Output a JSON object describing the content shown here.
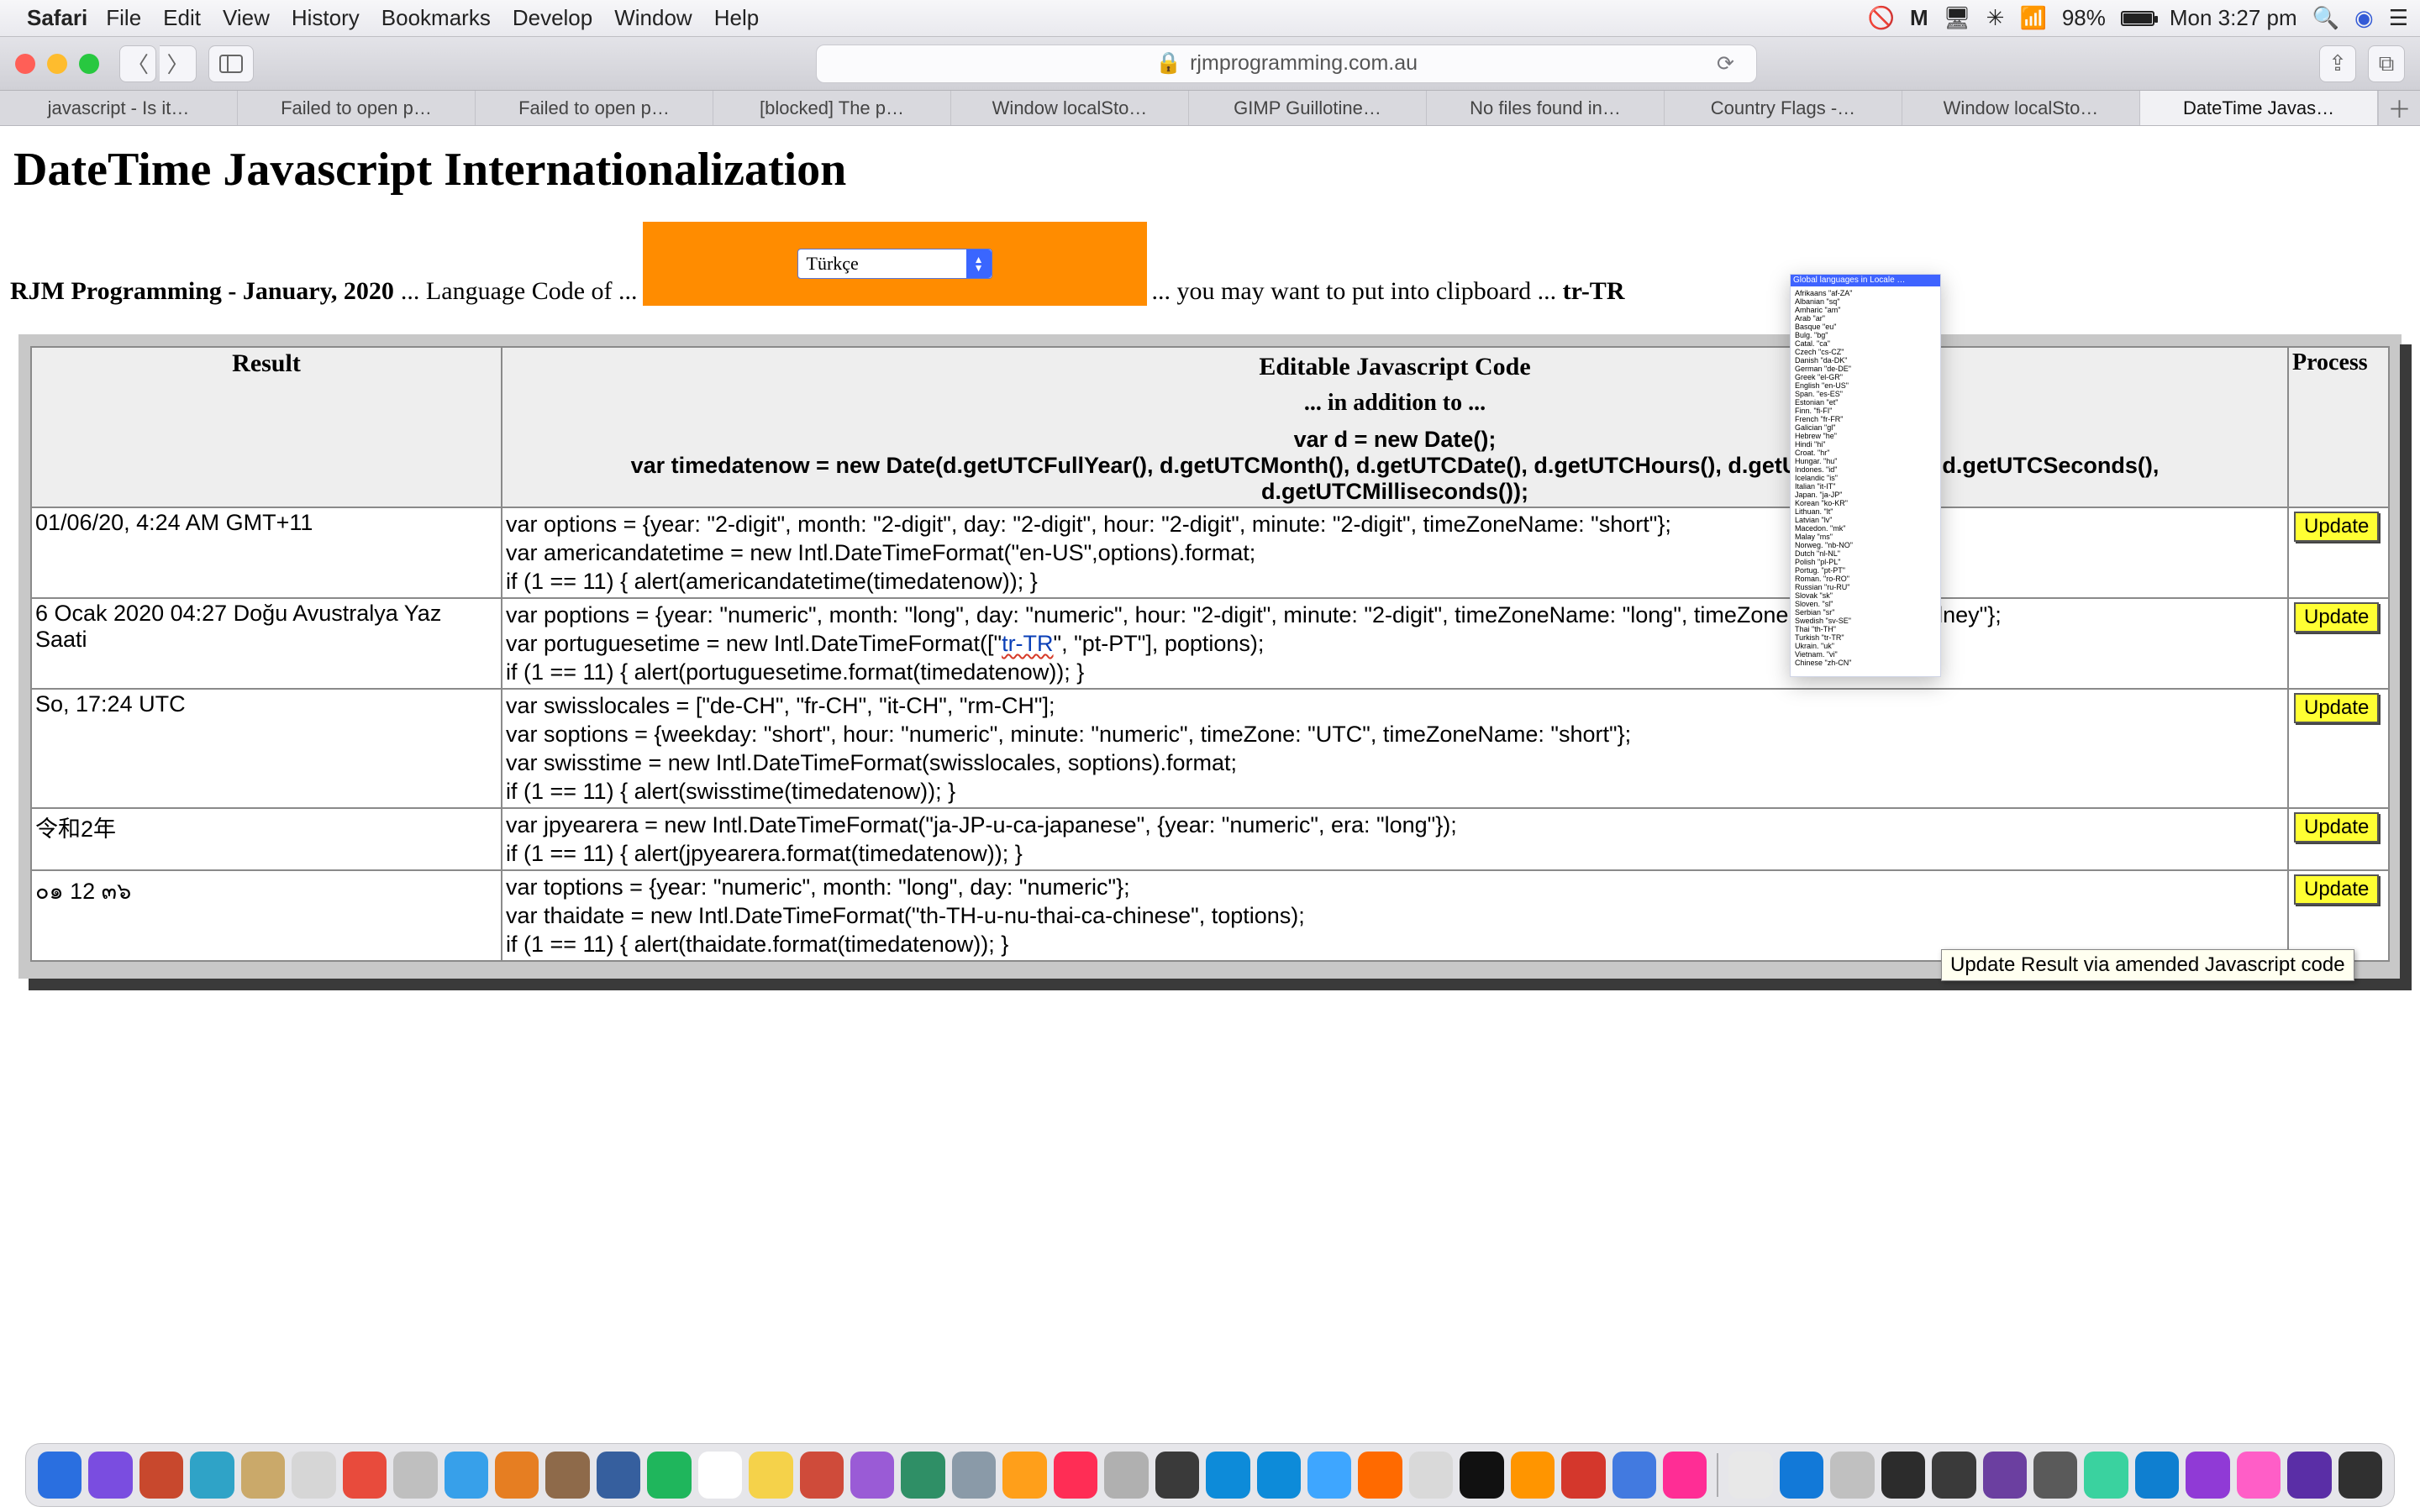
{
  "menubar": {
    "app": "Safari",
    "items": [
      "File",
      "Edit",
      "View",
      "History",
      "Bookmarks",
      "Develop",
      "Window",
      "Help"
    ],
    "battery_pct": "98%",
    "clock": "Mon 3:27 pm"
  },
  "toolbar": {
    "url_host": "rjmprogramming.com.au"
  },
  "tabs": [
    "javascript - Is it…",
    "Failed to open p…",
    "Failed to open p…",
    "[blocked] The p…",
    "Window localSto…",
    "GIMP Guillotine…",
    "No files found in…",
    "Country Flags -…",
    "Window localSto…",
    "DateTime Javas…"
  ],
  "active_tab_index": 9,
  "page": {
    "title": "DateTime Javascript Internationalization",
    "subtitle": "RJM Programming - January, 2020",
    "langcode_text": "... Language Code of ...",
    "language_selected": "Türkçe",
    "clip_prefix": "... you may want to put into clipboard ...",
    "clip_code": "tr-TR"
  },
  "locale_panel": {
    "header": "Global languages in Locale …",
    "rows": [
      "Afrikaans \"af-ZA\"",
      "Albanian \"sq\"",
      "Amharic \"am\"",
      "Arab \"ar\"",
      "Basque \"eu\"",
      "Bulg. \"bg\"",
      "Catal. \"ca\"",
      "Czech \"cs-CZ\"",
      "Danish \"da-DK\"",
      "German \"de-DE\"",
      "Greek \"el-GR\"",
      "English \"en-US\"",
      "Span. \"es-ES\"",
      "Estonian \"et\"",
      "Finn. \"fi-FI\"",
      "French \"fr-FR\"",
      "Galician \"gl\"",
      "Hebrew \"he\"",
      "Hindi \"hi\"",
      "Croat. \"hr\"",
      "Hungar. \"hu\"",
      "Indones. \"id\"",
      "Icelandic \"is\"",
      "Italian \"it-IT\"",
      "Japan. \"ja-JP\"",
      "Korean \"ko-KR\"",
      "Lithuan. \"lt\"",
      "Latvian \"lv\"",
      "Macedon. \"mk\"",
      "Malay \"ms\"",
      "Norweg. \"nb-NO\"",
      "Dutch \"nl-NL\"",
      "Polish \"pl-PL\"",
      "Portug. \"pt-PT\"",
      "Roman. \"ro-RO\"",
      "Russian \"ru-RU\"",
      "Slovak \"sk\"",
      "Sloven. \"sl\"",
      "Serbian \"sr\"",
      "Swedish \"sv-SE\"",
      "Thai \"th-TH\"",
      "Turkish \"tr-TR\"",
      "Ukrain. \"uk\"",
      "Vietnam. \"vi\"",
      "Chinese \"zh-CN\""
    ]
  },
  "table": {
    "headers": {
      "result": "Result",
      "code": "Editable Javascript Code",
      "process": "Process"
    },
    "addition": "... in addition to ...",
    "prelines": [
      "var d = new Date();",
      "var timedatenow = new Date(d.getUTCFullYear(), d.getUTCMonth(), d.getUTCDate(), d.getUTCHours(), d.getUTCMinutes(), d.getUTCSeconds(), d.getUTCMilliseconds());"
    ],
    "rows": [
      {
        "result": "01/06/20, 4:24 AM GMT+11",
        "code": [
          "var options = {year: \"2-digit\", month: \"2-digit\", day: \"2-digit\", hour: \"2-digit\", minute: \"2-digit\", timeZoneName: \"short\"};",
          "var americandatetime = new Intl.DateTimeFormat(\"en-US\",options).format;",
          "if (1 == 11) { alert(americandatetime(timedatenow)); }"
        ],
        "button": "Update"
      },
      {
        "result": "6 Ocak 2020 04:27 Doğu Avustralya Yaz Saati",
        "code_pre": "var poptions = {year: \"numeric\", month: \"long\", day: \"numeric\", hour: \"2-digit\", minute: \"2-digit\", timeZoneName: \"long\", timeZone: \"Australia/Sydney\"};",
        "code_mid_pre": "var portuguesetime = new Intl.DateTimeFormat([\"",
        "code_mid_locale": "tr-TR",
        "code_mid_post": "\", \"pt-PT\"], poptions);",
        "code_post": "if (1 == 11) { alert(portuguesetime.format(timedatenow)); }",
        "button": "Update"
      },
      {
        "result": "So, 17:24 UTC",
        "code": [
          "var swisslocales = [\"de-CH\", \"fr-CH\", \"it-CH\", \"rm-CH\"];",
          "var soptions = {weekday: \"short\", hour: \"numeric\", minute: \"numeric\", timeZone: \"UTC\", timeZoneName: \"short\"};",
          "var swisstime = new Intl.DateTimeFormat(swisslocales, soptions).format;",
          "if (1 == 11) { alert(swisstime(timedatenow)); }"
        ],
        "button": "Update"
      },
      {
        "result": "令和2年",
        "code": [
          "var jpyearera = new Intl.DateTimeFormat(\"ja-JP-u-ca-japanese\", {year: \"numeric\", era: \"long\"});",
          "if (1 == 11) { alert(jpyearera.format(timedatenow)); }"
        ],
        "button": "Update"
      },
      {
        "result": "๐๑ 12 ๓๖",
        "code": [
          "var toptions = {year: \"numeric\", month: \"long\", day: \"numeric\"};",
          "var thaidate = new Intl.DateTimeFormat(\"th-TH-u-nu-thai-ca-chinese\", toptions);",
          "if (1 == 11) { alert(thaidate.format(timedatenow)); }"
        ],
        "button": "Update"
      }
    ]
  },
  "tooltip": "Update Result via amended Javascript code",
  "dock_colors": [
    "#2a6fe0",
    "#7a4de0",
    "#c8482d",
    "#2fa3c7",
    "#caa96a",
    "#d6d6d6",
    "#e84b3c",
    "#bfbfbf",
    "#37a0ea",
    "#e67e22",
    "#8e6a4a",
    "#365f9e",
    "#1fb65c",
    "#ffffff",
    "#f5d24a",
    "#cf4b3a",
    "#9a5bd6",
    "#2f8f66",
    "#8a9aa8",
    "#ff9f1a",
    "#ff2d55",
    "#b0b0b0",
    "#3a3a3a",
    "#0d8bd9",
    "#0d8bd9",
    "#3ea6ff",
    "#ff6a00",
    "#d9d9d9",
    "#111111",
    "#ff9500",
    "#d4372c",
    "#427ae0",
    "#ff2d95",
    "#e8e8e8",
    "#1279d8",
    "#c0c0c0",
    "#2c2c2c",
    "#3a3a3a",
    "#6b3fa0",
    "#5a5a5a",
    "#3ad29f",
    "#0f7fd0",
    "#903ad6",
    "#ff5ec7",
    "#5a2ea6",
    "#303030"
  ]
}
